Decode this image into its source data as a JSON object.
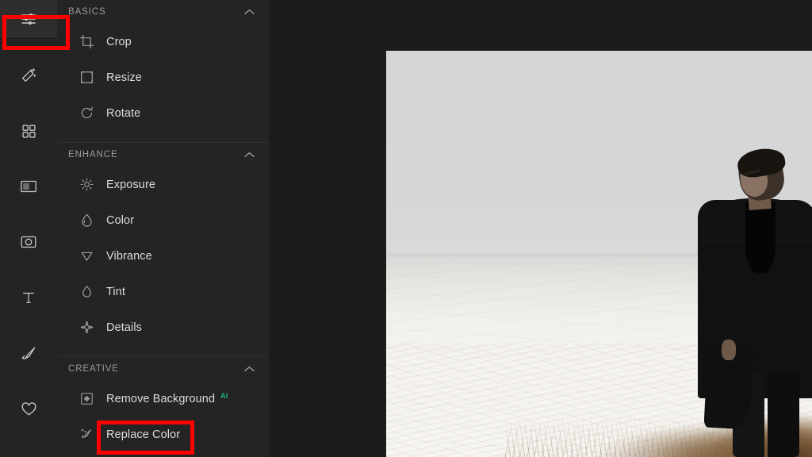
{
  "theme": {
    "panel_bg": "#242424",
    "canvas_bg": "#1c1c1c",
    "rail_bg": "#242424",
    "active_bg": "#2e2e2e",
    "label_color": "#dcdcdc",
    "section_color": "#9b9b9b",
    "accent_ai": "#19b98a",
    "annotation_color": "#ff0000"
  },
  "toolrail": {
    "items": [
      {
        "name": "adjust-icon",
        "tooltip": "Adjust",
        "active": true
      },
      {
        "name": "magic-wand-icon",
        "tooltip": "Effects",
        "active": false
      },
      {
        "name": "grid-icon",
        "tooltip": "Overlays",
        "active": false
      },
      {
        "name": "frame-icon",
        "tooltip": "Frames",
        "active": false
      },
      {
        "name": "sticker-icon",
        "tooltip": "Stickers",
        "active": false
      },
      {
        "name": "text-icon",
        "tooltip": "Text",
        "active": false
      },
      {
        "name": "brush-icon",
        "tooltip": "Draw",
        "active": false
      },
      {
        "name": "heart-icon",
        "tooltip": "Favorites",
        "active": false
      }
    ]
  },
  "panel": {
    "sections": [
      {
        "title": "BASICS",
        "collapse_icon": "chevron-up-icon",
        "expanded": true,
        "items": [
          {
            "label": "Crop",
            "icon": "crop-icon",
            "badge": null
          },
          {
            "label": "Resize",
            "icon": "resize-icon",
            "badge": null
          },
          {
            "label": "Rotate",
            "icon": "rotate-icon",
            "badge": null
          }
        ]
      },
      {
        "title": "ENHANCE",
        "collapse_icon": "chevron-up-icon",
        "expanded": true,
        "items": [
          {
            "label": "Exposure",
            "icon": "sun-icon",
            "badge": null
          },
          {
            "label": "Color",
            "icon": "droplet-icon",
            "badge": null
          },
          {
            "label": "Vibrance",
            "icon": "triangle-down-icon",
            "badge": null
          },
          {
            "label": "Tint",
            "icon": "tint-drop-icon",
            "badge": null
          },
          {
            "label": "Details",
            "icon": "sparkle-icon",
            "badge": null
          }
        ]
      },
      {
        "title": "CREATIVE",
        "collapse_icon": "chevron-up-icon",
        "expanded": true,
        "items": [
          {
            "label": "Remove Background",
            "icon": "remove-background-icon",
            "badge": "AI"
          },
          {
            "label": "Replace Color",
            "icon": "replace-color-icon",
            "badge": null
          }
        ]
      }
    ]
  },
  "canvas": {
    "photo_alt": "Man in dark coat standing on snowy field under misty grey sky"
  },
  "annotations": [
    {
      "name": "adjust-tool-highlight",
      "target": "adjust-icon"
    },
    {
      "name": "replace-color-highlight",
      "target": "Replace Color"
    }
  ]
}
